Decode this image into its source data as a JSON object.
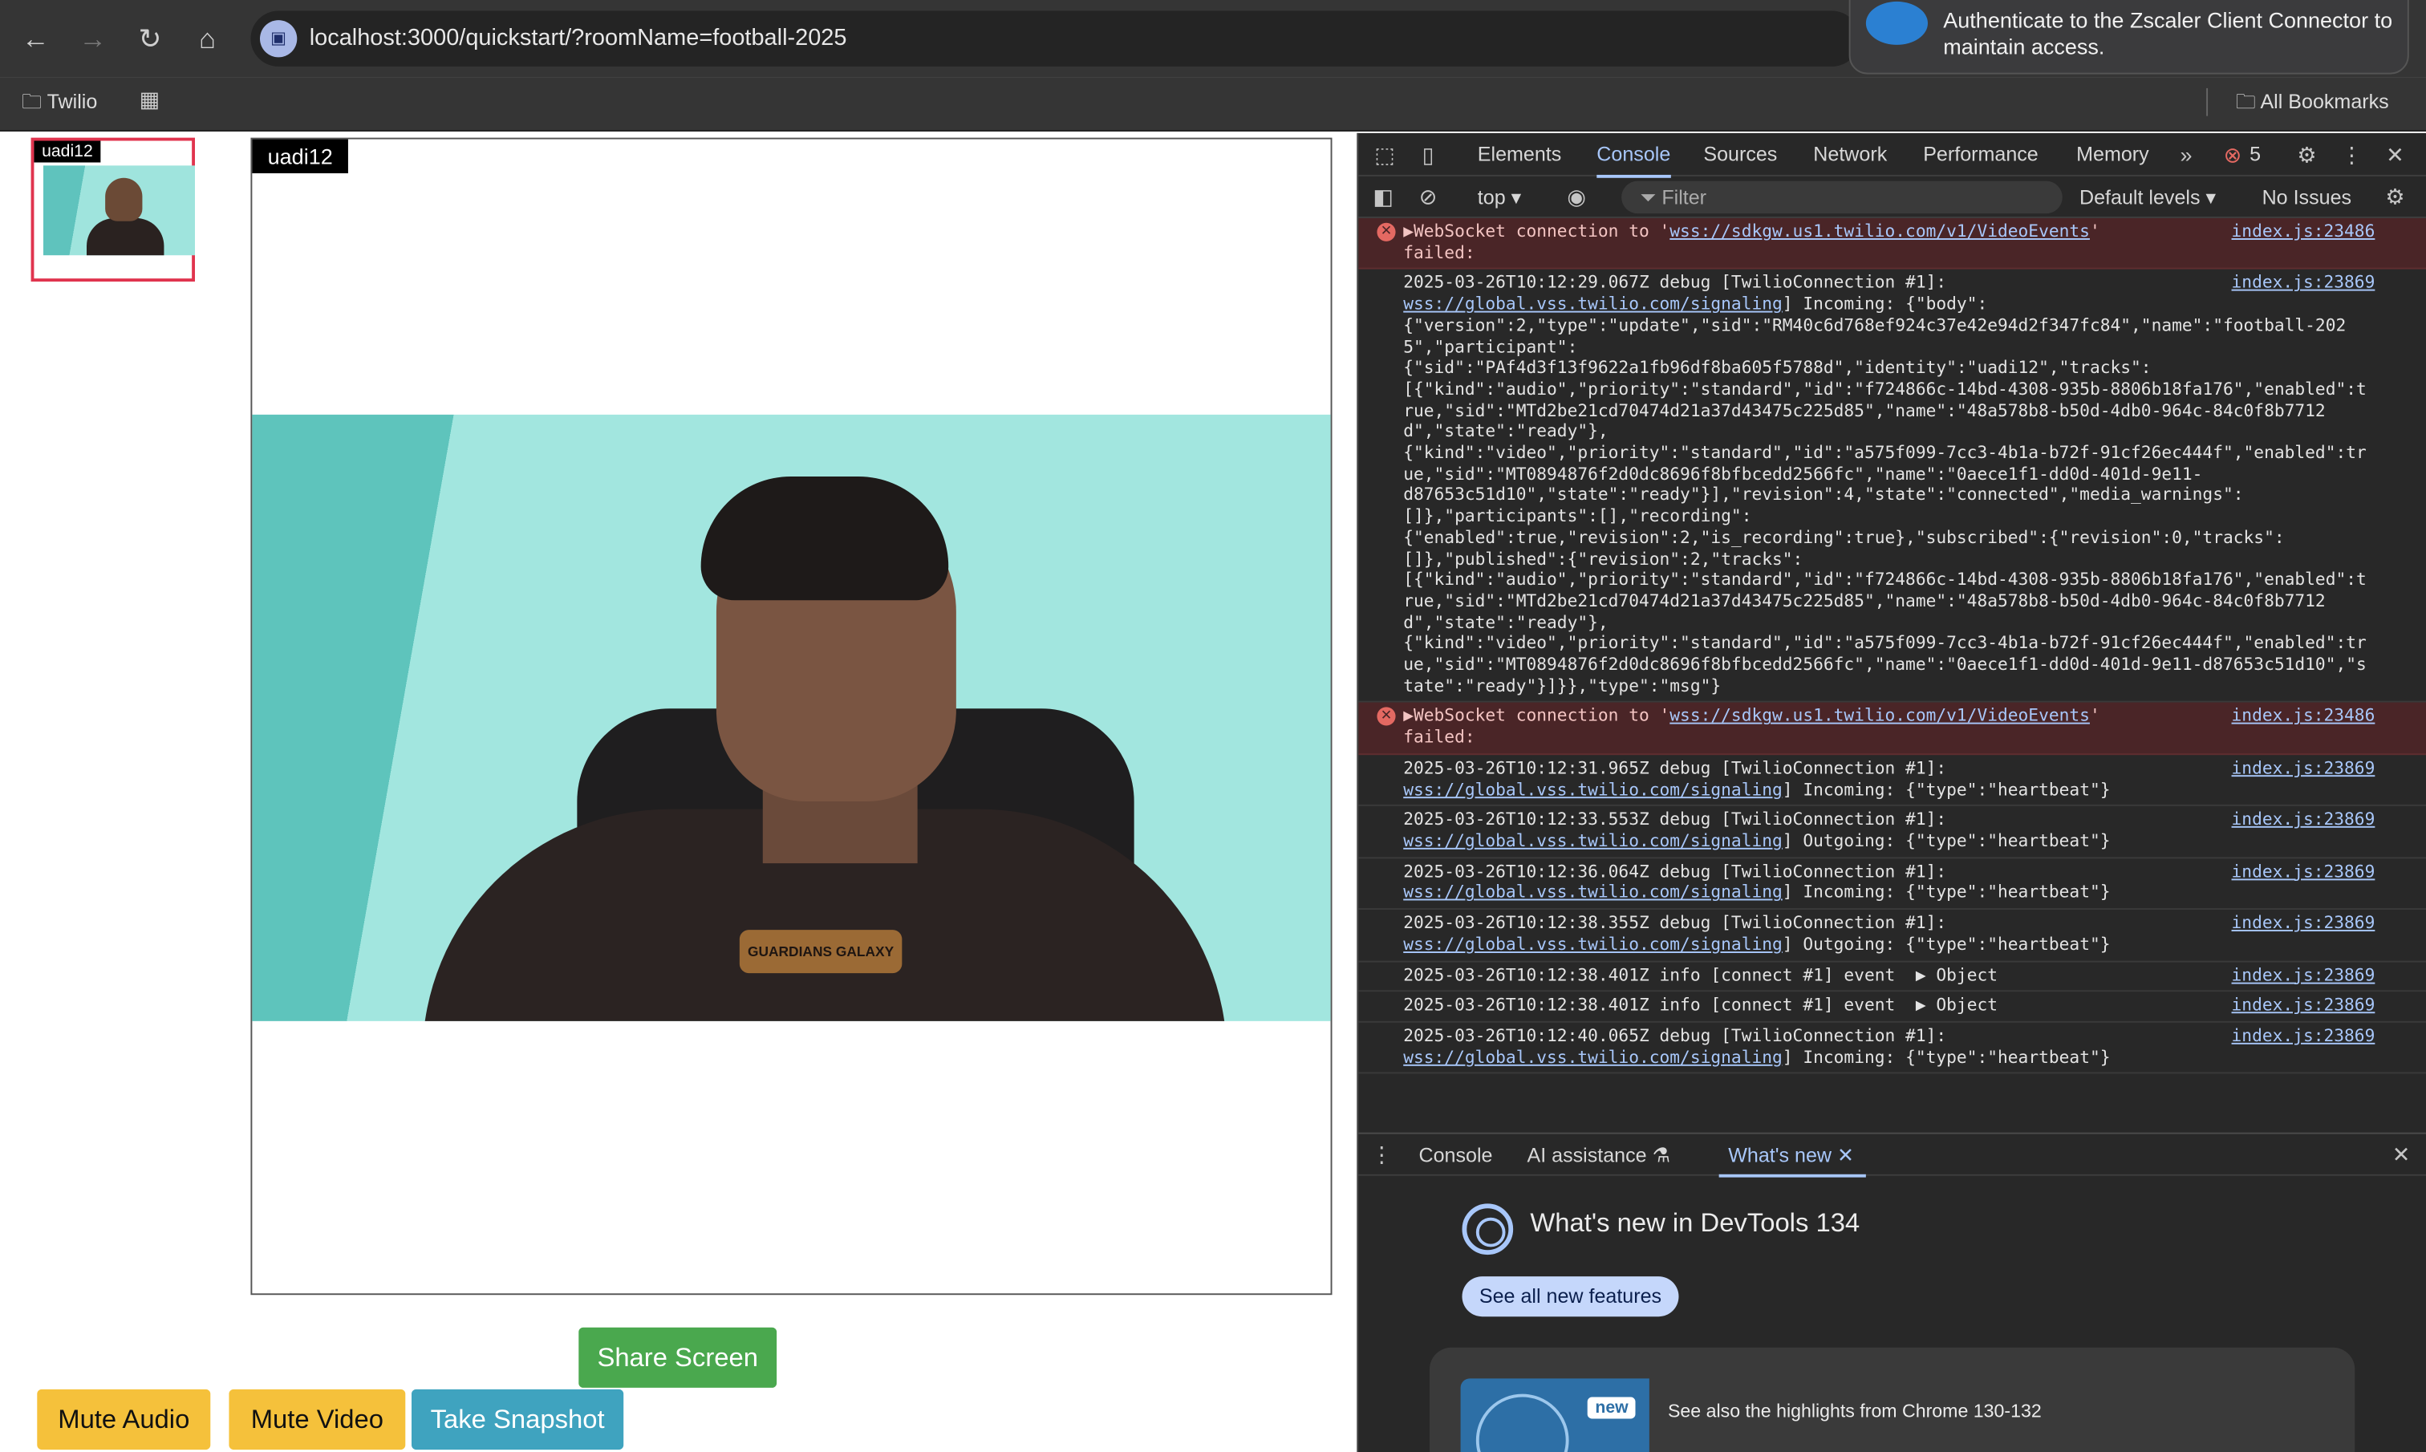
{
  "browser": {
    "url": "localhost:3000/quickstart/?roomName=football-2025",
    "nav_icons": [
      "back-icon",
      "forward-icon",
      "reload-icon",
      "home-icon"
    ],
    "bookmarks": {
      "folder": "Twilio",
      "all": "All Bookmarks"
    },
    "notification": {
      "text": "Authenticate to the Zscaler Client Connector to maintain access."
    }
  },
  "page": {
    "thumb_label": "uadi12",
    "main_label": "uadi12",
    "shirt_print": "GUARDIANS GALAXY",
    "buttons": {
      "share": "Share Screen",
      "mute_audio": "Mute Audio",
      "mute_video": "Mute Video",
      "snapshot": "Take Snapshot"
    },
    "colors": {
      "share": "#4aa84e",
      "mute": "#f5c13b",
      "snapshot": "#3fa3bf",
      "thumb_border": "#e0344e"
    }
  },
  "devtools": {
    "tabs": [
      "Elements",
      "Console",
      "Sources",
      "Network",
      "Performance",
      "Memory"
    ],
    "active_tab": "Console",
    "error_count": "5",
    "toolbar": {
      "context": "top",
      "filter": "Filter",
      "levels": "Default levels",
      "issues": "No Issues"
    },
    "logs": [
      {
        "type": "error",
        "prefix": "▶WebSocket connection to '",
        "link": "wss://sdkgw.us1.twilio.com/v1/VideoEvents",
        "suffix": "'\nfailed:",
        "src": "index.js:23486"
      },
      {
        "type": "log",
        "text": "2025-03-26T10:12:29.067Z debug [TwilioConnection #1]:\n",
        "link": "wss://global.vss.twilio.com/signaling",
        "suffix": "] Incoming: {\"body\":\n{\"version\":2,\"type\":\"update\",\"sid\":\"RM40c6d768ef924c37e42e94d2f347fc84\",\"name\":\"football-2025\",\"participant\":\n{\"sid\":\"PAf4d3f13f9622a1fb96df8ba605f5788d\",\"identity\":\"uadi12\",\"tracks\":\n[{\"kind\":\"audio\",\"priority\":\"standard\",\"id\":\"f724866c-14bd-4308-935b-8806b18fa176\",\"enabled\":true,\"sid\":\"MTd2be21cd70474d21a37d43475c225d85\",\"name\":\"48a578b8-b50d-4db0-964c-84c0f8b7712d\",\"state\":\"ready\"},\n{\"kind\":\"video\",\"priority\":\"standard\",\"id\":\"a575f099-7cc3-4b1a-b72f-91cf26ec444f\",\"enabled\":true,\"sid\":\"MT0894876f2d0dc8696f8bfbcedd2566fc\",\"name\":\"0aece1f1-dd0d-401d-9e11-\nd87653c51d10\",\"state\":\"ready\"}],\"revision\":4,\"state\":\"connected\",\"media_warnings\":\n[]},\"participants\":[],\"recording\":\n{\"enabled\":true,\"revision\":2,\"is_recording\":true},\"subscribed\":{\"revision\":0,\"tracks\":\n[]},\"published\":{\"revision\":2,\"tracks\":\n[{\"kind\":\"audio\",\"priority\":\"standard\",\"id\":\"f724866c-14bd-4308-935b-8806b18fa176\",\"enabled\":true,\"sid\":\"MTd2be21cd70474d21a37d43475c225d85\",\"name\":\"48a578b8-b50d-4db0-964c-84c0f8b7712d\",\"state\":\"ready\"},\n{\"kind\":\"video\",\"priority\":\"standard\",\"id\":\"a575f099-7cc3-4b1a-b72f-91cf26ec444f\",\"enabled\":true,\"sid\":\"MT0894876f2d0dc8696f8bfbcedd2566fc\",\"name\":\"0aece1f1-dd0d-401d-9e11-d87653c51d10\",\"state\":\"ready\"}]}},\"type\":\"msg\"}",
        "src": "index.js:23869"
      },
      {
        "type": "error",
        "prefix": "▶WebSocket connection to '",
        "link": "wss://sdkgw.us1.twilio.com/v1/VideoEvents",
        "suffix": "'\nfailed:",
        "src": "index.js:23486"
      },
      {
        "type": "log",
        "text": "2025-03-26T10:12:31.965Z debug [TwilioConnection #1]:\n",
        "link": "wss://global.vss.twilio.com/signaling",
        "suffix": "] Incoming: {\"type\":\"heartbeat\"}",
        "src": "index.js:23869"
      },
      {
        "type": "log",
        "text": "2025-03-26T10:12:33.553Z debug [TwilioConnection #1]:\n",
        "link": "wss://global.vss.twilio.com/signaling",
        "suffix": "] Outgoing: {\"type\":\"heartbeat\"}",
        "src": "index.js:23869"
      },
      {
        "type": "log",
        "text": "2025-03-26T10:12:36.064Z debug [TwilioConnection #1]:\n",
        "link": "wss://global.vss.twilio.com/signaling",
        "suffix": "] Incoming: {\"type\":\"heartbeat\"}",
        "src": "index.js:23869"
      },
      {
        "type": "log",
        "text": "2025-03-26T10:12:38.355Z debug [TwilioConnection #1]:\n",
        "link": "wss://global.vss.twilio.com/signaling",
        "suffix": "] Outgoing: {\"type\":\"heartbeat\"}",
        "src": "index.js:23869"
      },
      {
        "type": "obj",
        "text": "2025-03-26T10:12:38.401Z info [connect #1] event  ",
        "obj": "▶ Object",
        "src": "index.js:23869"
      },
      {
        "type": "obj",
        "text": "2025-03-26T10:12:38.401Z info [connect #1] event  ",
        "obj": "▶ Object",
        "src": "index.js:23869"
      },
      {
        "type": "log",
        "text": "2025-03-26T10:12:40.065Z debug [TwilioConnection #1]:\n",
        "link": "wss://global.vss.twilio.com/signaling",
        "suffix": "] Incoming: {\"type\":\"heartbeat\"}",
        "src": "index.js:23869"
      }
    ],
    "drawer": {
      "tabs": [
        "Console",
        "AI assistance",
        "What's new"
      ],
      "active": "What's new",
      "title": "What's new in DevTools 134",
      "button": "See all new features",
      "badge": "new",
      "highlights": "See also the highlights from Chrome 130-132"
    }
  }
}
